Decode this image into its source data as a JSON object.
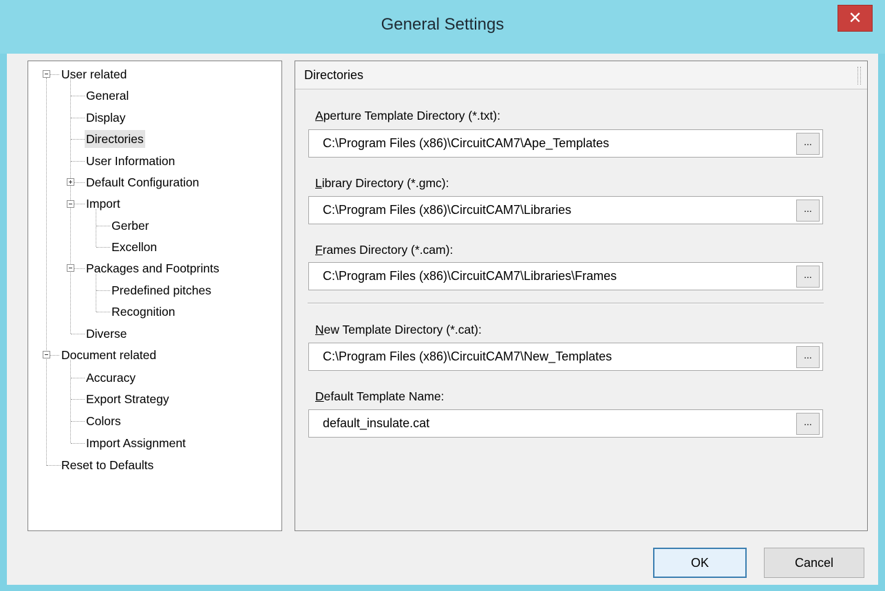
{
  "window": {
    "title": "General Settings",
    "close_glyph": "✕"
  },
  "tree": {
    "items": [
      {
        "label": "User related",
        "expander": "minus"
      },
      {
        "label": "General"
      },
      {
        "label": "Display"
      },
      {
        "label": "Directories",
        "selected": true
      },
      {
        "label": "User Information"
      },
      {
        "label": "Default Configuration",
        "expander": "plus"
      },
      {
        "label": "Import",
        "expander": "minus"
      },
      {
        "label": "Gerber"
      },
      {
        "label": "Excellon"
      },
      {
        "label": "Packages and Footprints",
        "expander": "minus"
      },
      {
        "label": "Predefined pitches"
      },
      {
        "label": "Recognition"
      },
      {
        "label": "Diverse"
      },
      {
        "label": "Document related",
        "expander": "minus"
      },
      {
        "label": "Accuracy"
      },
      {
        "label": "Export Strategy"
      },
      {
        "label": "Colors"
      },
      {
        "label": "Import Assignment"
      },
      {
        "label": "Reset to Defaults"
      }
    ]
  },
  "panel": {
    "title": "Directories",
    "fields": [
      {
        "mnemonic": "A",
        "label_rest": "perture Template Directory (*.txt):",
        "value": "C:\\Program Files (x86)\\CircuitCAM7\\Ape_Templates",
        "browse": "..."
      },
      {
        "mnemonic": "L",
        "label_rest": "ibrary  Directory (*.gmc):",
        "value": "C:\\Program Files (x86)\\CircuitCAM7\\Libraries",
        "browse": "..."
      },
      {
        "mnemonic": "F",
        "label_rest": "rames Directory (*.cam):",
        "value": "C:\\Program Files (x86)\\CircuitCAM7\\Libraries\\Frames",
        "browse": "..."
      },
      {
        "mnemonic": "N",
        "label_rest": "ew Template Directory (*.cat):",
        "value": "C:\\Program Files (x86)\\CircuitCAM7\\New_Templates",
        "browse": "..."
      },
      {
        "mnemonic": "D",
        "label_rest": "efault Template Name:",
        "value": "default_insulate.cat",
        "browse": "..."
      }
    ]
  },
  "buttons": {
    "ok": "OK",
    "cancel": "Cancel"
  }
}
